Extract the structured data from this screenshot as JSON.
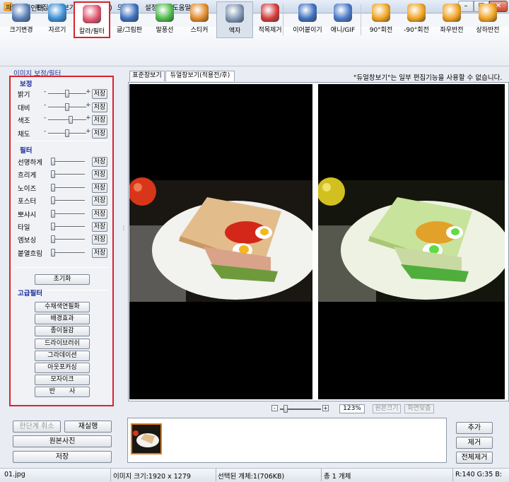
{
  "window": {
    "title": "한페인터"
  },
  "menu": [
    "파일(F)",
    "편집(E)",
    "보기(V)",
    "효과(I)",
    "도구(T)",
    "설정(S)",
    "도움말(H)"
  ],
  "toolbar": [
    {
      "label": "크기변경",
      "icon": "resize-icon"
    },
    {
      "label": "자르기",
      "icon": "crop-icon"
    },
    {
      "label": "칼라/필터",
      "icon": "color-filter-icon"
    },
    {
      "label": "글/그림판",
      "icon": "text-draw-icon"
    },
    {
      "label": "말풍선",
      "icon": "speech-bubble-icon"
    },
    {
      "label": "스티커",
      "icon": "sticker-icon"
    },
    {
      "label": "액자",
      "icon": "frame-icon"
    },
    {
      "label": "적목제거",
      "icon": "red-eye-icon"
    },
    {
      "label": "이어붙이기",
      "icon": "merge-icon"
    },
    {
      "label": "애니/GIF",
      "icon": "animation-icon"
    },
    {
      "label": "90°회전",
      "icon": "rotate-right-icon"
    },
    {
      "label": "-90°회전",
      "icon": "rotate-left-icon"
    },
    {
      "label": "좌우반전",
      "icon": "flip-horizontal-icon"
    },
    {
      "label": "상하반전",
      "icon": "flip-vertical-icon"
    }
  ],
  "panel": {
    "title": "이미지 보정/필터",
    "correction_title": "보정",
    "correction": [
      {
        "label": "밝기",
        "level": 0.5
      },
      {
        "label": "대비",
        "level": 0.5
      },
      {
        "label": "색조",
        "level": 0.6
      },
      {
        "label": "채도",
        "level": 0.5
      }
    ],
    "filter_title": "필터",
    "filters": [
      {
        "label": "선명하게",
        "level": 0.0
      },
      {
        "label": "흐리게",
        "level": 0.0
      },
      {
        "label": "노이즈",
        "level": 0.0
      },
      {
        "label": "포스터",
        "level": 0.0
      },
      {
        "label": "뽀샤시",
        "level": 0.0
      },
      {
        "label": "타일",
        "level": 0.0
      },
      {
        "label": "엠보싱",
        "level": 0.0
      },
      {
        "label": "붙열흐림",
        "level": 0.0
      }
    ],
    "minus": "-",
    "plus": "+",
    "save_label": "저장",
    "reset_label": "초기화",
    "advanced_title": "고급필터",
    "advanced": [
      "수채색연필화",
      "배경효과",
      "종이질감",
      "드라이브러쉬",
      "그라데이션",
      "아웃포커싱",
      "모자이크",
      "반       사"
    ]
  },
  "tabs": [
    "표준창보기",
    "듀얼창보기(적용전/후)"
  ],
  "notice": "\"듀얼창보기\"는 일부 편집기능을 사용할 수 없습니다.",
  "zoom": {
    "minus": "-",
    "plus": "+",
    "value": "123%",
    "level": 0.1,
    "original_size": "원본크기",
    "fit_screen": "화면맞춤"
  },
  "left_buttons": {
    "undo": "한단계 취소",
    "redo": "재실행",
    "original": "원본사진",
    "save": "저장"
  },
  "right_buttons": {
    "add": "추가",
    "remove": "제거",
    "remove_all": "전체제거"
  },
  "status": {
    "file": "01.jpg",
    "size": "이미지 크기:1920 x 1279",
    "selected": "선택된 개체:1(706KB)",
    "total": "총 1 개체",
    "color": "R:140 G:35 B:"
  },
  "colors": {
    "highlight": "#d9232b",
    "section_title": "#1d2f9a"
  }
}
